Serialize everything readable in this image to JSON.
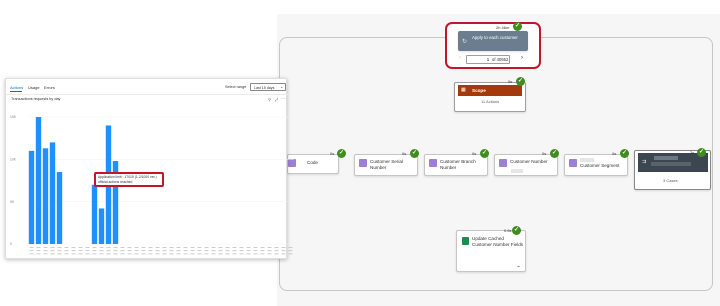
{
  "flow": {
    "apply_to_each": {
      "title": "Apply to each customer",
      "duration": "2h 46m",
      "page_current": "1",
      "page_total": "of 40652",
      "prev_icon": "chevron-left-icon",
      "next_icon": "chevron-right-icon"
    },
    "scope": {
      "title": "Scope",
      "duration": "0s",
      "subtitle": "11 Actions",
      "color": "#a4390b"
    },
    "actions": [
      {
        "title": "Code",
        "duration": "0s"
      },
      {
        "title": "Customer Serial Number",
        "duration": "0s"
      },
      {
        "title": "Customer Branch Number",
        "duration": "0s"
      },
      {
        "title": "Customer Number",
        "duration": "0s"
      },
      {
        "title": "Customer Segment",
        "duration": "0s"
      }
    ],
    "condition": {
      "duration": "2s",
      "subtitle": "3 Cases"
    },
    "update": {
      "title": "Update Cached Customer Number Fields",
      "duration": "0.6s"
    },
    "highlight_color": "#c4162a",
    "success_color": "#3f8d1f"
  },
  "panel": {
    "tabs": [
      "Actions",
      "Usage",
      "Errors"
    ],
    "time_range_label": "Select range",
    "time_range_value": "Last 15 days",
    "chart_title": "Transactions requests by day",
    "tooltip": "Application limit : 17015 (1.2/1000 ver.)\nofficial actions     reached"
  },
  "chart_data": {
    "type": "bar",
    "title": "Transactions requests by day",
    "xlabel": "",
    "ylabel": "",
    "y_ticks": [
      "15K",
      "10K",
      "5K",
      "0"
    ],
    "ylim": [
      0,
      15000
    ],
    "categories": [
      "",
      "",
      "",
      "",
      "",
      "",
      "",
      "",
      "",
      "",
      "",
      "",
      "",
      "",
      "",
      "",
      "",
      "",
      "",
      "",
      "",
      "",
      "",
      "",
      "",
      "",
      "",
      "",
      "",
      "",
      "",
      "",
      "",
      "",
      "",
      "",
      "",
      ""
    ],
    "values": [
      11000,
      15000,
      11300,
      12000,
      8500,
      0,
      0,
      0,
      0,
      7000,
      4200,
      14000,
      9800,
      0,
      0,
      0,
      0,
      0,
      0,
      0,
      0,
      0,
      0,
      0,
      0,
      0,
      0,
      0,
      0,
      0,
      0,
      0,
      0,
      0,
      0,
      0,
      0,
      0
    ],
    "color": "#1e90ff"
  }
}
